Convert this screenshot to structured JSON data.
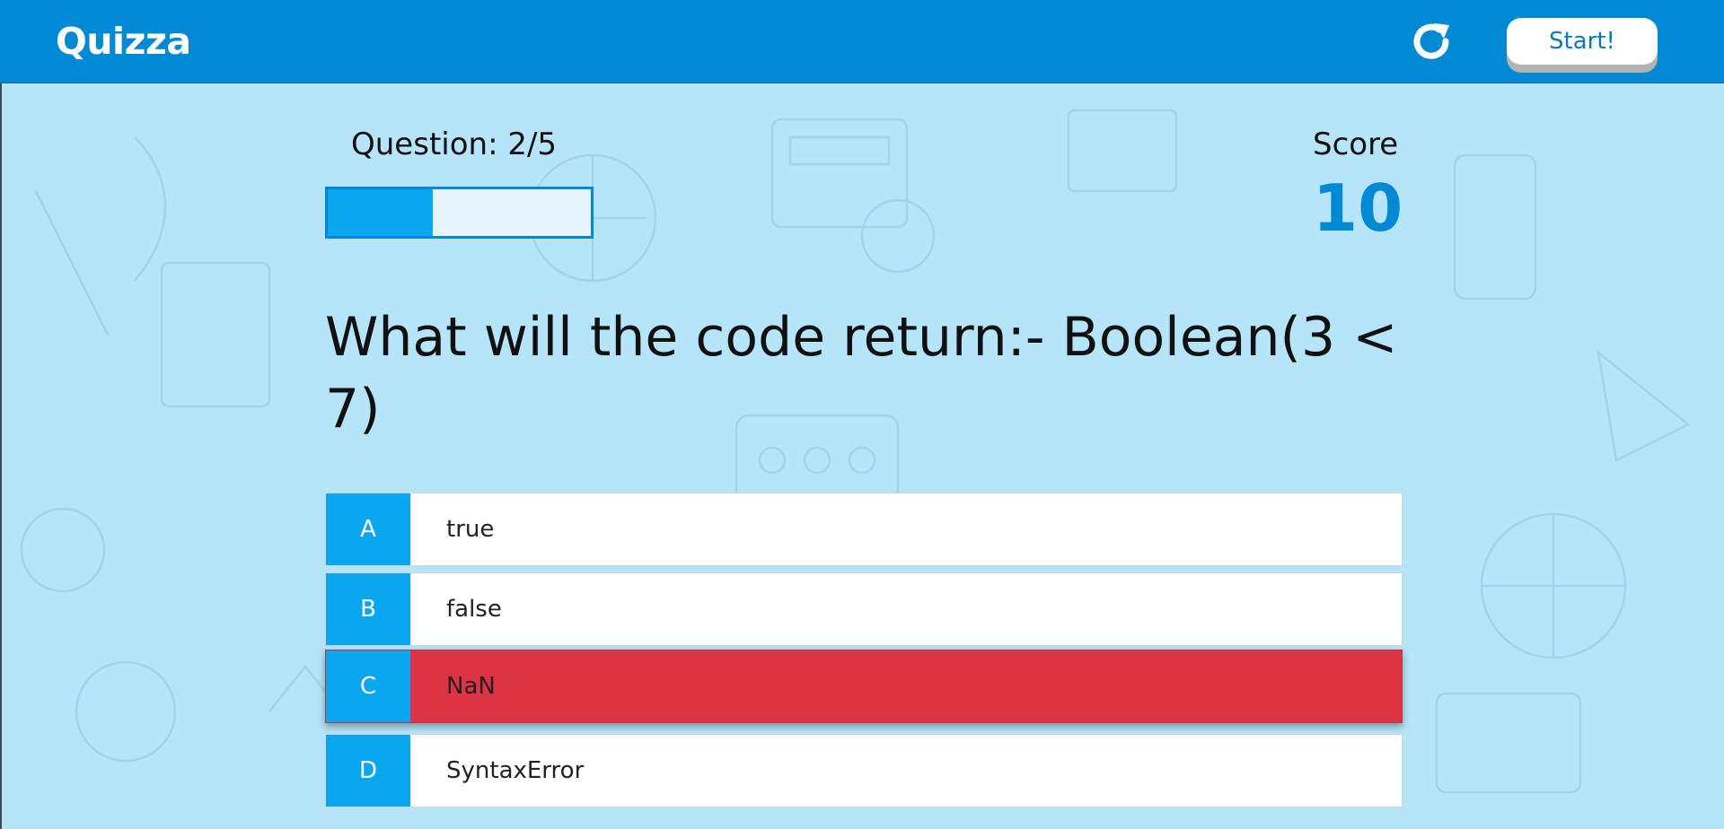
{
  "app": {
    "title": "Quizza"
  },
  "header": {
    "start_label": "Start!",
    "reload_icon": "reload-icon"
  },
  "hud": {
    "question_counter": "Question: 2/5",
    "progress_fraction": 0.4,
    "score_label": "Score",
    "score_value": "10"
  },
  "question": {
    "text": "What will the code return:- Boolean(3 < 7)"
  },
  "answers": [
    {
      "prefix": "A",
      "text": "true"
    },
    {
      "prefix": "B",
      "text": "false"
    },
    {
      "prefix": "C",
      "text": "NaN",
      "state": "incorrect"
    },
    {
      "prefix": "D",
      "text": "SyntaxError"
    }
  ],
  "colors": {
    "header": "#0289d3",
    "background": "#b6e4f9",
    "accent": "#0aa6ef",
    "incorrect": "#db3545",
    "score": "#0289d3"
  }
}
